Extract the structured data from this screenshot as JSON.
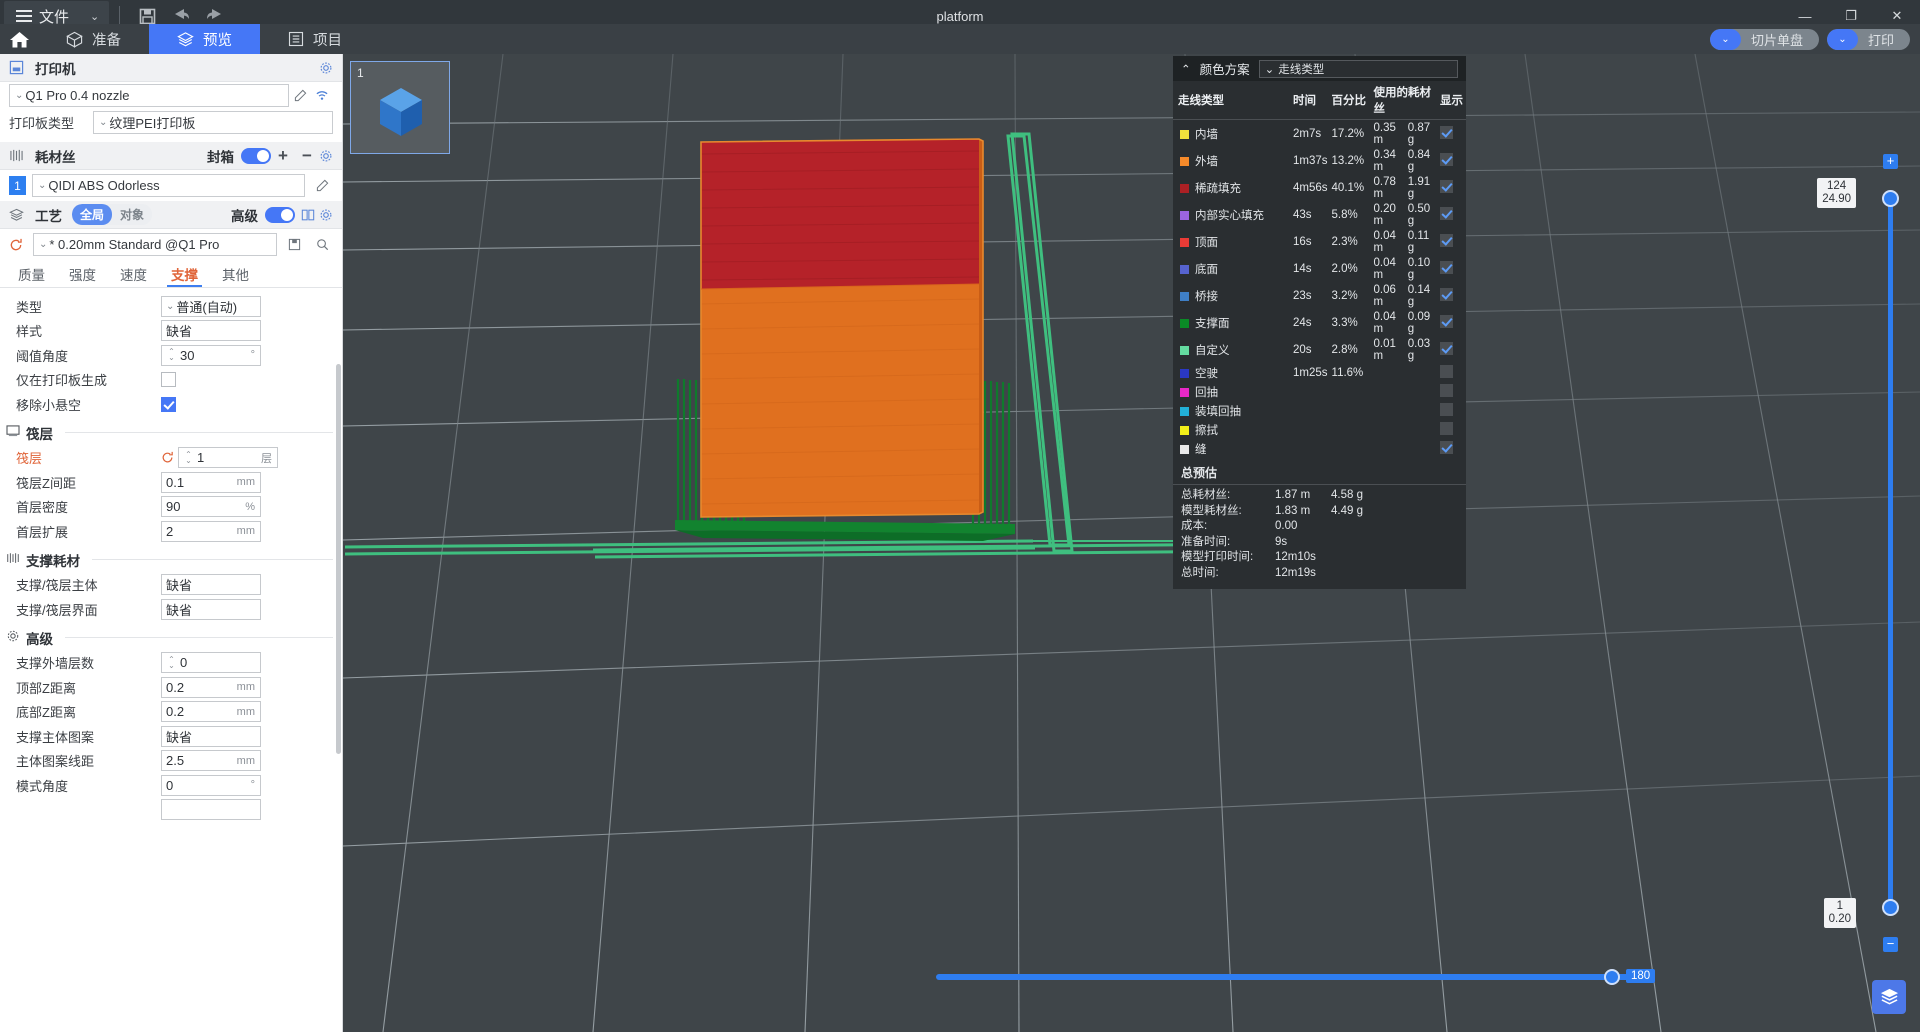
{
  "titlebar": {
    "file_label": "文件",
    "window_title": "platform",
    "icons": {
      "save": "save-icon",
      "undo": "undo-icon",
      "redo": "redo-icon"
    },
    "window_buttons": {
      "minimize": "—",
      "maximize": "❐",
      "close": "✕"
    }
  },
  "nav": {
    "home": "home-icon",
    "tabs": [
      {
        "label": "准备",
        "icon": "box-icon",
        "active": false
      },
      {
        "label": "预览",
        "icon": "layers-icon",
        "active": true
      },
      {
        "label": "项目",
        "icon": "project-icon",
        "active": false
      }
    ],
    "actions": [
      {
        "label": "切片单盘"
      },
      {
        "label": "打印"
      }
    ]
  },
  "printer": {
    "section_title": "打印机",
    "model": "Q1 Pro 0.4 nozzle",
    "plate_label": "打印板类型",
    "plate_value": "纹理PEI打印板"
  },
  "filament": {
    "section_title": "耗材丝",
    "enclosure_label": "封箱",
    "enclosure_on": true,
    "add": "+",
    "remove": "−",
    "items": [
      {
        "index": "1",
        "name": "QIDI ABS Odorless"
      }
    ]
  },
  "process": {
    "section_title": "工艺",
    "scope_global": "全局",
    "scope_object": "对象",
    "advanced_label": "高级",
    "advanced_on": true,
    "preset": "* 0.20mm Standard @Q1 Pro",
    "tabs": [
      {
        "label": "质量",
        "active": false
      },
      {
        "label": "强度",
        "active": false
      },
      {
        "label": "速度",
        "active": false
      },
      {
        "label": "支撑",
        "active": true
      },
      {
        "label": "其他",
        "active": false
      }
    ],
    "support_rows": [
      {
        "label": "类型",
        "value": "普通(自动)",
        "kind": "dropdown",
        "unit": ""
      },
      {
        "label": "样式",
        "value": "缺省",
        "kind": "text",
        "unit": ""
      },
      {
        "label": "阈值角度",
        "value": "30",
        "kind": "spinner",
        "unit": "°"
      },
      {
        "label": "仅在打印板生成",
        "value": "",
        "kind": "checkbox",
        "checked": false,
        "unit": ""
      },
      {
        "label": "移除小悬空",
        "value": "",
        "kind": "checkbox",
        "checked": true,
        "unit": ""
      }
    ],
    "raft_group": "筏层",
    "raft_rows": [
      {
        "label": "筏层",
        "value": "1",
        "kind": "spinner",
        "unit": "层",
        "modified": true
      },
      {
        "label": "筏层Z间距",
        "value": "0.1",
        "kind": "text",
        "unit": "mm"
      },
      {
        "label": "首层密度",
        "value": "90",
        "kind": "text",
        "unit": "%"
      },
      {
        "label": "首层扩展",
        "value": "2",
        "kind": "text",
        "unit": "mm"
      }
    ],
    "support_material_group": "支撑耗材",
    "support_material_rows": [
      {
        "label": "支撑/筏层主体",
        "value": "缺省",
        "kind": "text",
        "unit": ""
      },
      {
        "label": "支撑/筏层界面",
        "value": "缺省",
        "kind": "text",
        "unit": ""
      }
    ],
    "advanced_group": "高级",
    "advanced_rows": [
      {
        "label": "支撑外墙层数",
        "value": "0",
        "kind": "spinner",
        "unit": ""
      },
      {
        "label": "顶部Z距离",
        "value": "0.2",
        "kind": "text",
        "unit": "mm"
      },
      {
        "label": "底部Z距离",
        "value": "0.2",
        "kind": "text",
        "unit": "mm"
      },
      {
        "label": "支撑主体图案",
        "value": "缺省",
        "kind": "text",
        "unit": ""
      },
      {
        "label": "主体图案线距",
        "value": "2.5",
        "kind": "text",
        "unit": "mm"
      },
      {
        "label": "模式角度",
        "value": "0",
        "kind": "text",
        "unit": "°"
      }
    ]
  },
  "viewport": {
    "thumbnail_label": "1",
    "vertical_slider": {
      "top_value": "124",
      "top_sub": "24.90",
      "bottom_value": "1",
      "bottom_sub": "0.20"
    },
    "horizontal_slider": {
      "value": "180"
    },
    "layer_button_icon": "layers-icon"
  },
  "legend": {
    "collapse_icon": "chevron-up-icon",
    "title": "颜色方案",
    "scheme_value": "走线类型",
    "columns": [
      "走线类型",
      "时间",
      "百分比",
      "使用的耗材丝",
      "显示"
    ],
    "rows": [
      {
        "color": "#f0e03c",
        "name": "内墙",
        "time": "2m7s",
        "percent": "17.2%",
        "length": "0.35 m",
        "weight": "0.87 g",
        "visible": true
      },
      {
        "color": "#f58a2a",
        "name": "外墙",
        "time": "1m37s",
        "percent": "13.2%",
        "length": "0.34 m",
        "weight": "0.84 g",
        "visible": true
      },
      {
        "color": "#ab2024",
        "name": "稀疏填充",
        "time": "4m56s",
        "percent": "40.1%",
        "length": "0.78 m",
        "weight": "1.91 g",
        "visible": true
      },
      {
        "color": "#9b64e0",
        "name": "内部实心填充",
        "time": "43s",
        "percent": "5.8%",
        "length": "0.20 m",
        "weight": "0.50 g",
        "visible": true
      },
      {
        "color": "#e93b36",
        "name": "顶面",
        "time": "16s",
        "percent": "2.3%",
        "length": "0.04 m",
        "weight": "0.11 g",
        "visible": true
      },
      {
        "color": "#5663cf",
        "name": "底面",
        "time": "14s",
        "percent": "2.0%",
        "length": "0.04 m",
        "weight": "0.10 g",
        "visible": true
      },
      {
        "color": "#3f7fc6",
        "name": "桥接",
        "time": "23s",
        "percent": "3.2%",
        "length": "0.06 m",
        "weight": "0.14 g",
        "visible": true
      },
      {
        "color": "#0a8a26",
        "name": "支撑面",
        "time": "24s",
        "percent": "3.3%",
        "length": "0.04 m",
        "weight": "0.09 g",
        "visible": true
      },
      {
        "color": "#64dba0",
        "name": "自定义",
        "time": "20s",
        "percent": "2.8%",
        "length": "0.01 m",
        "weight": "0.03 g",
        "visible": true
      },
      {
        "color": "#2a38c4",
        "name": "空驶",
        "time": "1m25s",
        "percent": "11.6%",
        "length": "",
        "weight": "",
        "visible": false
      },
      {
        "color": "#e828c8",
        "name": "回抽",
        "time": "",
        "percent": "",
        "length": "",
        "weight": "",
        "visible": false
      },
      {
        "color": "#22b0d8",
        "name": "装填回抽",
        "time": "",
        "percent": "",
        "length": "",
        "weight": "",
        "visible": false
      },
      {
        "color": "#f2ef19",
        "name": "擦拭",
        "time": "",
        "percent": "",
        "length": "",
        "weight": "",
        "visible": false
      },
      {
        "color": "#e9e9e9",
        "name": "缝",
        "time": "",
        "percent": "",
        "length": "",
        "weight": "",
        "visible": true
      }
    ],
    "estimate_title": "总预估",
    "estimate_rows": [
      {
        "key": "总耗材丝:",
        "v1": "1.87 m",
        "v2": "4.58 g"
      },
      {
        "key": "模型耗材丝:",
        "v1": "1.83 m",
        "v2": "4.49 g"
      },
      {
        "key": "成本:",
        "v1": "0.00",
        "v2": ""
      },
      {
        "key": "准备时间:",
        "v1": "9s",
        "v2": ""
      },
      {
        "key": "模型打印时间:",
        "v1": "12m10s",
        "v2": ""
      },
      {
        "key": "总时间:",
        "v1": "12m19s",
        "v2": ""
      }
    ]
  },
  "colors": {
    "accent": "#4577f6",
    "modified": "#e0653a",
    "viewport_bg": "#3f4549"
  }
}
